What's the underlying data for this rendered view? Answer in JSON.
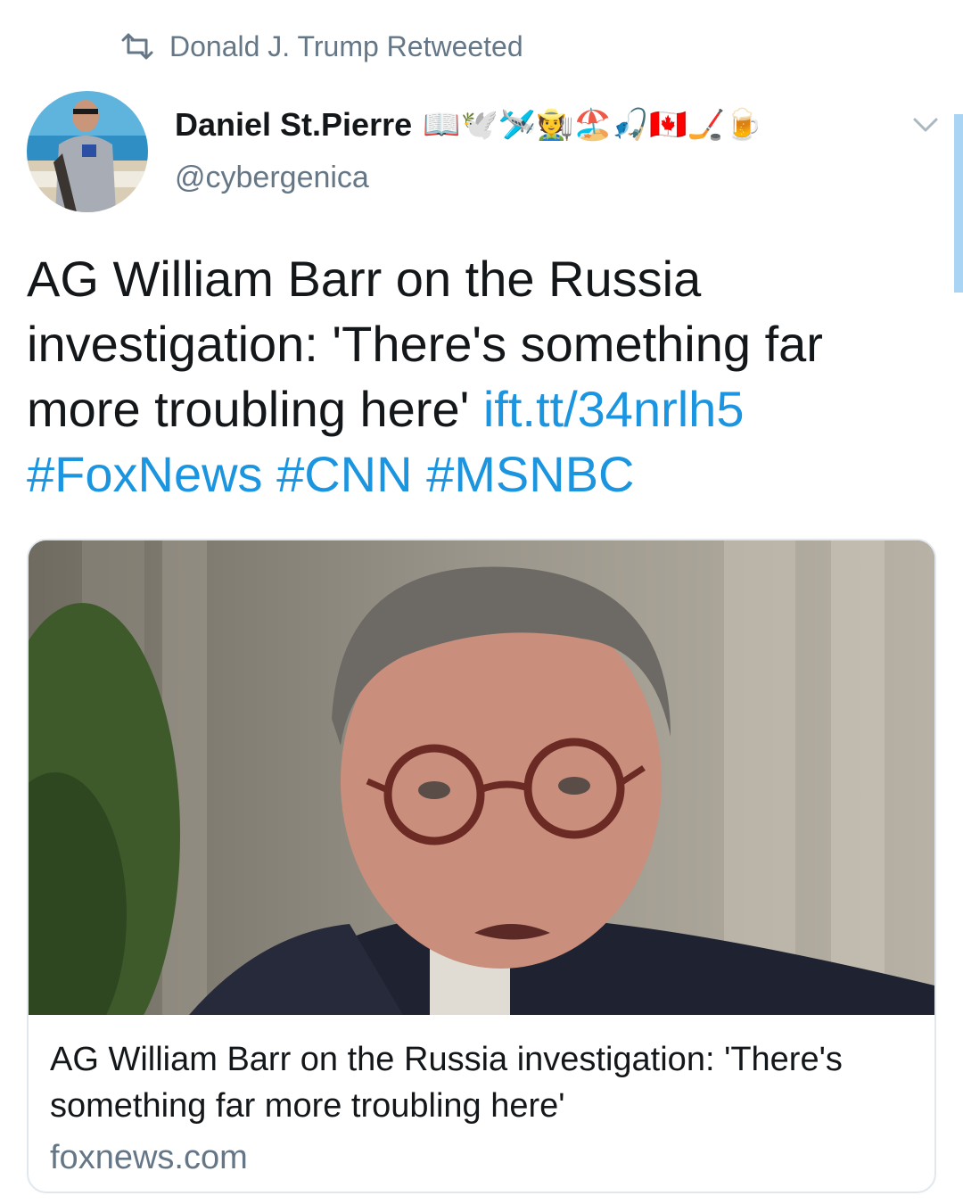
{
  "retweet": {
    "label": "Donald J. Trump Retweeted",
    "icon": "retweet-icon"
  },
  "author": {
    "name": "Daniel St.Pierre",
    "handle": "@cybergenica",
    "emojis": [
      "📖",
      "🕊️",
      "🛩️",
      "🧑‍🌾",
      "🏖️",
      "🎣",
      "🇨🇦",
      "🏒",
      "🍺"
    ]
  },
  "tweet": {
    "text": "AG William Barr on the Russia investigation: 'There's something far more troubling here' ",
    "short_link": "ift.tt/34nrlh5",
    "hashtags": "#FoxNews #CNN #MSNBC"
  },
  "card": {
    "title": "AG William Barr on the Russia investigation: 'There's something far more troubling here'",
    "domain": "foxnews.com"
  },
  "colors": {
    "link": "#1b95e0",
    "secondary_text": "#657786",
    "border": "#e1e8ed"
  }
}
